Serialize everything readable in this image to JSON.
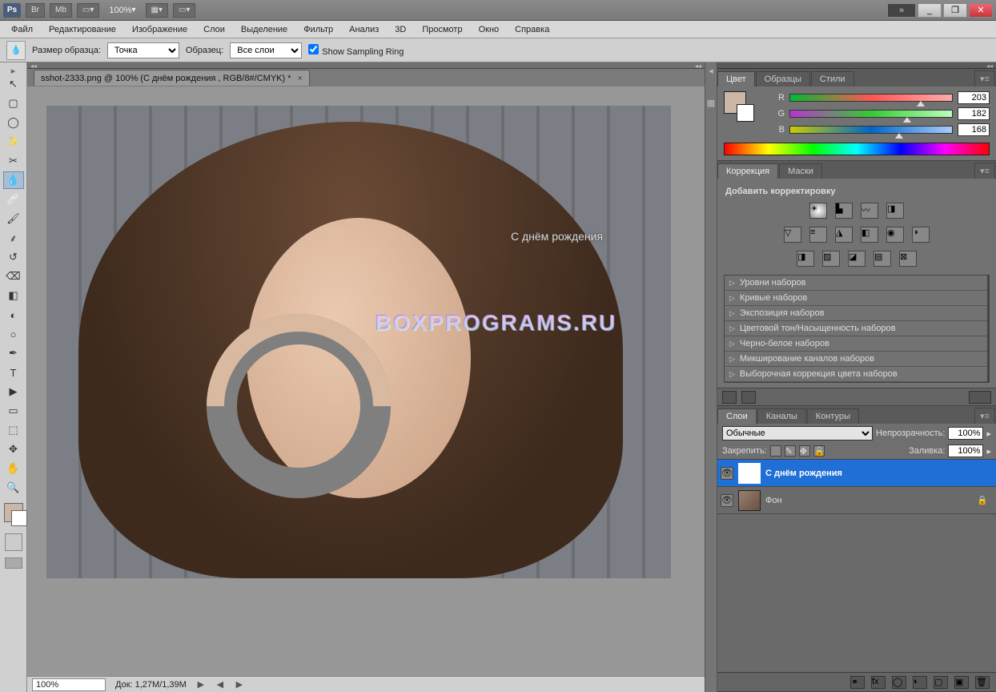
{
  "titlebar": {
    "app_badge": "Ps",
    "btn_br": "Br",
    "btn_mb": "Mb",
    "zoom": "100%"
  },
  "window_controls": {
    "min": "_",
    "max": "❐",
    "close": "✕",
    "expand": "»"
  },
  "menu": [
    "Файл",
    "Редактирование",
    "Изображение",
    "Слои",
    "Выделение",
    "Фильтр",
    "Анализ",
    "3D",
    "Просмотр",
    "Окно",
    "Справка"
  ],
  "options": {
    "sample_size_label": "Размер образца:",
    "sample_size_value": "Точка",
    "sample_label": "Образец:",
    "sample_value": "Все слои",
    "show_ring_label": "Show Sampling Ring",
    "show_ring_checked": true
  },
  "document": {
    "tab_title": "sshot-2333.png @ 100% (С днём рождения , RGB/8#/CMYK) *",
    "overlay_text": "С днём рождения",
    "watermark": "BOXPROGRAMS.RU"
  },
  "statusbar": {
    "zoom": "100%",
    "doc_info": "Док: 1,27M/1,39M"
  },
  "color_panel": {
    "tabs": [
      "Цвет",
      "Образцы",
      "Стили"
    ],
    "r": 203,
    "g": 182,
    "b": 168
  },
  "adjust_panel": {
    "tabs": [
      "Коррекция",
      "Маски"
    ],
    "add_label": "Добавить корректировку",
    "presets": [
      "Уровни наборов",
      "Кривые наборов",
      "Экспозиция наборов",
      "Цветовой тон/Насыщенность наборов",
      "Черно-белое наборов",
      "Микширование каналов наборов",
      "Выборочная коррекция цвета наборов"
    ]
  },
  "layers_panel": {
    "tabs": [
      "Слои",
      "Каналы",
      "Контуры"
    ],
    "blend_mode": "Обычные",
    "opacity_label": "Непрозрачность:",
    "opacity_value": "100%",
    "lock_label": "Закрепить:",
    "fill_label": "Заливка:",
    "fill_value": "100%",
    "layers": [
      {
        "name": "С днём рождения",
        "type": "T",
        "selected": true,
        "locked": false
      },
      {
        "name": "Фон",
        "type": "img",
        "selected": false,
        "locked": true
      }
    ]
  },
  "tools": [
    "↖",
    "▢",
    "◯",
    "✂",
    "▧",
    "💧",
    "🖌",
    "↙",
    "⌫",
    "🖊",
    "⬛",
    "◐",
    "▭",
    "○",
    "✒",
    "T",
    "▶",
    "✥",
    "🔍",
    "🤚",
    "⟳",
    "Q"
  ]
}
